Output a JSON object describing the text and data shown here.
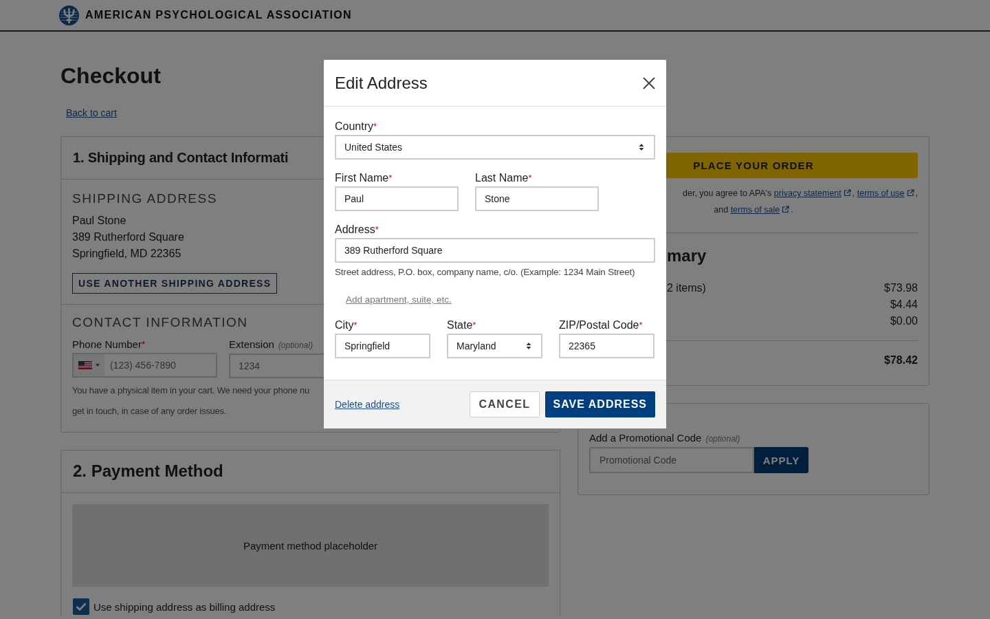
{
  "header": {
    "org_name": "AMERICAN PSYCHOLOGICAL ASSOCIATION"
  },
  "page": {
    "title": "Checkout",
    "back_link": "Back to cart"
  },
  "required_mark": "*",
  "shipping_card": {
    "title": "1. Shipping and Contact Informati",
    "shipping_heading": "SHIPPING ADDRESS",
    "address_lines": [
      "Paul Stone",
      "389 Rutherford Square",
      "Springfield, MD 22365"
    ],
    "another_button": "USE ANOTHER SHIPPING ADDRESS",
    "contact_heading": "CONTACT INFORMATION",
    "phone": {
      "label": "Phone Number",
      "required": true,
      "placeholder": "(123) 456-7890"
    },
    "extension": {
      "label": "Extension",
      "optional_note": "(optional)",
      "placeholder": "1234"
    },
    "note_lines": [
      "You have a physical item in your cart. We need your phone nu",
      "get in touch, in case of any order issues."
    ]
  },
  "payment_card": {
    "title": "2. Payment Method",
    "placeholder_text": "Payment method placeholder",
    "billing_checkbox": {
      "label": "Use shipping address as billing address",
      "checked": true
    }
  },
  "order_card": {
    "place_order_button": "PLACE YOUR ORDER",
    "legal_lines": [
      [
        {
          "kind": "text",
          "text": "der, you agree to APA's "
        },
        {
          "kind": "link",
          "text": "privacy statement"
        },
        {
          "kind": "text",
          "text": ", "
        },
        {
          "kind": "link",
          "text": "terms of use"
        },
        {
          "kind": "text",
          "text": ","
        }
      ],
      [
        {
          "kind": "text",
          "text": "and "
        },
        {
          "kind": "link",
          "text": "terms of sale"
        },
        {
          "kind": "text",
          "text": "."
        }
      ]
    ],
    "summary_heading": "mary",
    "rows": [
      {
        "label": "2 items)",
        "amount": "$73.98"
      },
      {
        "amount": "$4.44"
      },
      {
        "amount": "$0.00"
      }
    ],
    "total": "$78.42"
  },
  "promo_card": {
    "label": "Add a Promotional Code",
    "optional_note": "(optional)",
    "placeholder": "Promotional Code",
    "apply_button": "APPLY"
  },
  "modal": {
    "title": "Edit Address",
    "rows": [
      {
        "fields": [
          {
            "kind": "select",
            "label": "Country",
            "required": true,
            "value": "United States"
          }
        ]
      },
      {
        "fields": [
          {
            "kind": "text",
            "label": "First Name",
            "required": true,
            "value": "Paul"
          },
          {
            "kind": "text",
            "label": "Last Name",
            "required": true,
            "value": "Stone"
          }
        ]
      },
      {
        "fields": [
          {
            "kind": "text",
            "label": "Address",
            "required": true,
            "value": "389 Rutherford Square"
          }
        ],
        "hint": "Street address, P.O. box, company name, c/o. (Example: 1234 Main Street)",
        "link": "Add apartment, suite, etc."
      },
      {
        "fields": [
          {
            "kind": "text",
            "label": "City",
            "required": true,
            "value": "Springfield"
          },
          {
            "kind": "select",
            "label": "State",
            "required": true,
            "value": "Maryland"
          },
          {
            "kind": "text",
            "label": "ZIP/Postal Code",
            "required": true,
            "value": "22365"
          }
        ]
      }
    ],
    "delete_link": "Delete address",
    "cancel_button": "CANCEL",
    "save_button": "SAVE ADDRESS"
  }
}
